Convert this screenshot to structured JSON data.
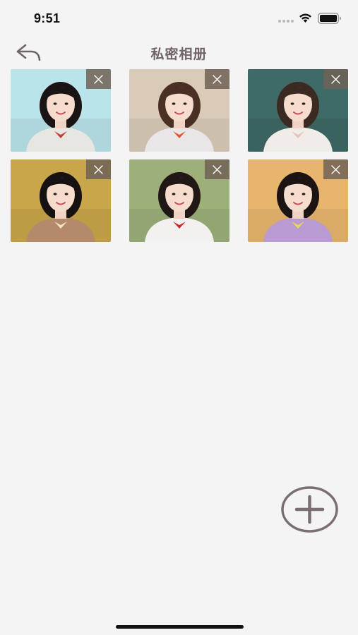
{
  "status_bar": {
    "time": "9:51"
  },
  "nav": {
    "title": "私密相册",
    "back_icon": "back-arrow-icon"
  },
  "photos": [
    {
      "name": "photo-1",
      "bg": "#b9e4ea",
      "hair": "#1a1414",
      "top": "#e8e6e0",
      "accent": "#c43c3c"
    },
    {
      "name": "photo-2",
      "bg": "#d9cbb8",
      "hair": "#4a3024",
      "top": "#e9e6e8",
      "accent": "#e0582a"
    },
    {
      "name": "photo-3",
      "bg": "#3e6a67",
      "hair": "#3a2a22",
      "top": "#f0ece8",
      "accent": "#e8c2b4"
    },
    {
      "name": "photo-4",
      "bg": "#c9a64a",
      "hair": "#171211",
      "top": "#b48a6a",
      "accent": "#efe3c8"
    },
    {
      "name": "photo-5",
      "bg": "#9db07a",
      "hair": "#211816",
      "top": "#f2f1f0",
      "accent": "#d0242a"
    },
    {
      "name": "photo-6",
      "bg": "#e8b56e",
      "hair": "#1b1413",
      "top": "#b99ad3",
      "accent": "#e6d94a"
    }
  ],
  "icons": {
    "delete": "close-icon",
    "add": "plus-circle-icon"
  },
  "colors": {
    "background": "#f4f4f4",
    "title": "#6f6468",
    "delete_overlay": "#706256",
    "add_button": "#7a6e72"
  }
}
